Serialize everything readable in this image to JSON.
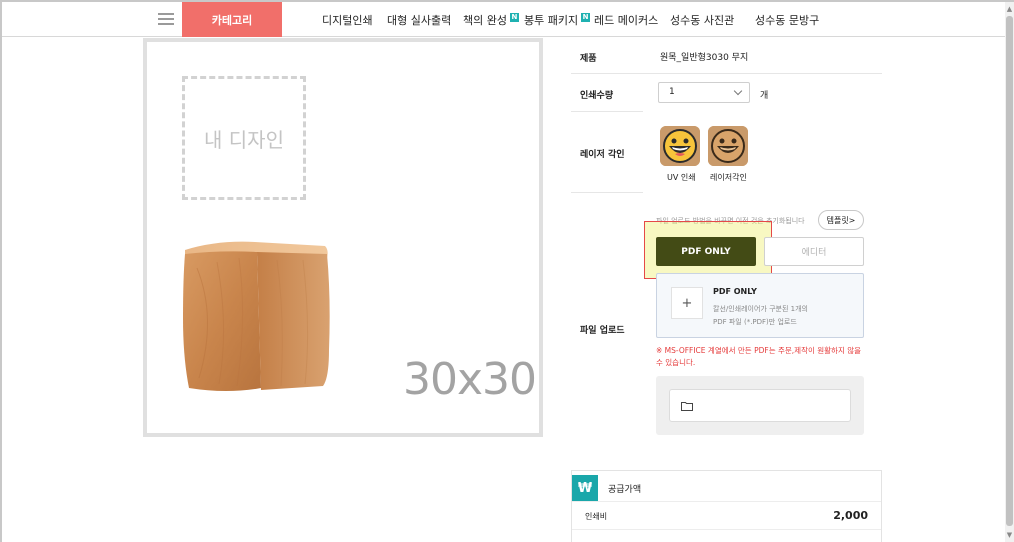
{
  "nav": {
    "category_label": "카테고리",
    "items": [
      {
        "label": "디지털인쇄",
        "badge": ""
      },
      {
        "label": "대형 실사출력",
        "badge": ""
      },
      {
        "label": "책의 완성",
        "badge": "N"
      },
      {
        "label": "봉투 패키지",
        "badge": "N"
      },
      {
        "label": "레드 메이커스",
        "badge": ""
      },
      {
        "label": "성수동 사진관",
        "badge": ""
      },
      {
        "label": "성수동 문방구",
        "badge": ""
      }
    ]
  },
  "preview": {
    "my_design_label": "내 디자인",
    "size_label": "30x30"
  },
  "options": {
    "product_label": "제품",
    "product_value": "원목_일반형3030 무지",
    "quantity_label": "인쇄수량",
    "quantity_value": "1",
    "quantity_unit": "개",
    "laser_label": "레이저 각인",
    "print_types": [
      {
        "label": "UV 인쇄",
        "icon": "grinning-face-icon"
      },
      {
        "label": "레이저각인",
        "icon": "grinning-face-engraved-icon"
      }
    ],
    "upload_label": "파일 업로드"
  },
  "upload": {
    "notice": "파일 업로드 방법을 바꾸면 이전 것은 초기화됩니다",
    "template_button": "템플릿>",
    "pdf_button": "PDF ONLY",
    "editor_button": "에디터",
    "box_title": "PDF ONLY",
    "box_desc_line1": "칼선/인쇄레이어가 구분된 1개의",
    "box_desc_line2": "PDF 파일 (*.PDF)만 업로드",
    "warning": "※ MS-OFFICE 계열에서 만든 PDF는 주문,제작이 원활하지 않을 수 있습니다."
  },
  "price": {
    "badge": "₩",
    "title": "공급가액",
    "print_fee_label": "인쇄비",
    "print_fee_value": "2,000"
  },
  "colors": {
    "category_bg": "#f16f6a",
    "pdf_button_bg": "#434b15",
    "badge_teal": "#1aa7aa",
    "new_badge": "#1fb1b1",
    "warning_red": "#e53a3a"
  }
}
